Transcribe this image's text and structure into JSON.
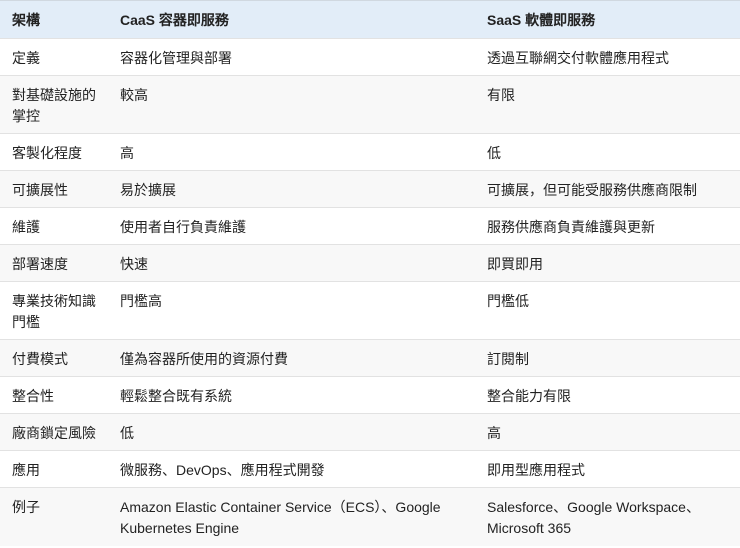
{
  "headers": [
    "架構",
    "CaaS 容器即服務",
    "SaaS 軟體即服務"
  ],
  "rows": [
    [
      "定義",
      "容器化管理與部署",
      "透過互聯網交付軟體應用程式"
    ],
    [
      "對基礎設施的掌控",
      "較高",
      "有限"
    ],
    [
      "客製化程度",
      "高",
      "低"
    ],
    [
      "可擴展性",
      "易於擴展",
      "可擴展，但可能受服務供應商限制"
    ],
    [
      "維護",
      "使用者自行負責維護",
      "服務供應商負責維護與更新"
    ],
    [
      "部署速度",
      "快速",
      "即買即用"
    ],
    [
      "專業技術知識門檻",
      "門檻高",
      "門檻低"
    ],
    [
      "付費模式",
      "僅為容器所使用的資源付費",
      "訂閱制"
    ],
    [
      "整合性",
      "輕鬆整合既有系統",
      "整合能力有限"
    ],
    [
      "廠商鎖定風險",
      "低",
      "高"
    ],
    [
      "應用",
      "微服務、DevOps、應用程式開發",
      "即用型應用程式"
    ],
    [
      "例子",
      "Amazon Elastic Container Service（ECS）、Google Kubernetes Engine",
      "Salesforce、Google Workspace、Microsoft 365"
    ]
  ]
}
